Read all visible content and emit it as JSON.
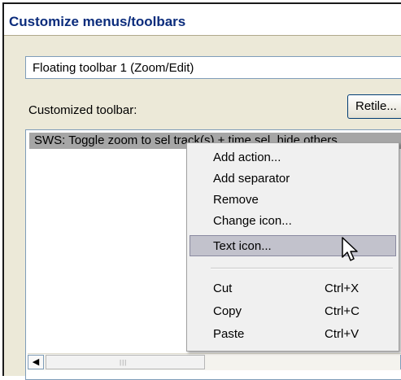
{
  "dialog": {
    "title": "Customize menus/toolbars"
  },
  "toolbar_select": {
    "value": "Floating toolbar 1 (Zoom/Edit)"
  },
  "customized": {
    "label": "Customized toolbar:",
    "retile_label": "Retile..."
  },
  "list": {
    "items": [
      {
        "label": "SWS: Toggle zoom to sel track(s) + time sel, hide others"
      }
    ]
  },
  "scrollbar": {
    "grip": "|||"
  },
  "context_menu": {
    "items": [
      {
        "label": "Add action...",
        "shortcut": ""
      },
      {
        "label": "Add separator",
        "shortcut": ""
      },
      {
        "label": "Remove",
        "shortcut": ""
      },
      {
        "label": "Change icon...",
        "shortcut": ""
      },
      {
        "label": "Text icon...",
        "shortcut": "",
        "highlighted": true
      },
      {
        "label": "Cut",
        "shortcut": "Ctrl+X"
      },
      {
        "label": "Copy",
        "shortcut": "Ctrl+C"
      },
      {
        "label": "Paste",
        "shortcut": "Ctrl+V"
      }
    ]
  },
  "icons": {
    "dropdown": "chevron-down-icon",
    "scroll_left": "arrow-left-icon",
    "cursor": "mouse-pointer-icon"
  },
  "colors": {
    "title_text": "#0b2c7c",
    "list_selection": "#a6a6a6",
    "menu_highlight": "#c2c2cc",
    "dialog_bg": "#ece9d8"
  }
}
